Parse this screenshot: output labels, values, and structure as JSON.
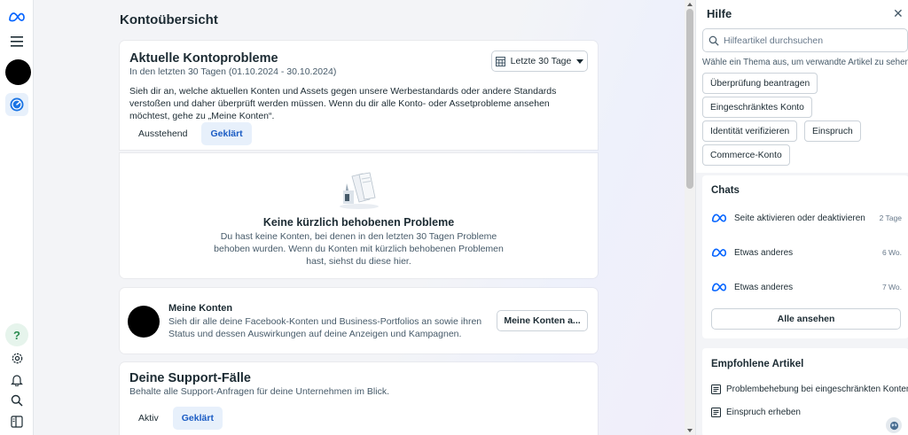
{
  "rail": {
    "logo_icon": "meta-logo-icon",
    "menu_icon": "hamburger-menu-icon",
    "dashboard_icon": "gauge-icon",
    "bottom_icons": [
      "help-circle-icon",
      "gear-icon",
      "bell-icon",
      "search-icon",
      "sidebar-panel-icon"
    ]
  },
  "main": {
    "title": "Kontoübersicht",
    "issues": {
      "title": "Aktuelle Kontoprobleme",
      "subtitle": "In den letzten 30 Tagen (01.10.2024 - 30.10.2024)",
      "date_filter": "Letzte 30 Tage",
      "description": "Sieh dir an, welche aktuellen Konten und Assets gegen unsere Werbestandards oder andere Standards verstoßen und daher überprüft werden müssen. Wenn du dir alle Konto- oder Assetprobleme ansehen möchtest, gehe zu „Meine Konten“.",
      "tabs": [
        "Ausstehend",
        "Geklärt"
      ],
      "selected_tab": "Geklärt",
      "empty_title": "Keine kürzlich behobenen Probleme",
      "empty_text": "Du hast keine Konten, bei denen in den letzten 30 Tagen Probleme behoben wurden. Wenn du Konten mit kürzlich behobenen Problemen hast, siehst du diese hier."
    },
    "accounts": {
      "title": "Meine Konten",
      "text": "Sieh dir alle deine Facebook-Konten und Business-Portfolios an sowie ihren Status und dessen Auswirkungen auf deine Anzeigen und Kampagnen.",
      "button": "Meine Konten a..."
    },
    "support": {
      "title": "Deine Support-Fälle",
      "subtitle": "Behalte alle Support-Anfragen für deine Unternehmen im Blick.",
      "tabs": [
        "Aktiv",
        "Geklärt"
      ],
      "selected_tab": "Geklärt"
    }
  },
  "help": {
    "title": "Hilfe",
    "search_placeholder": "Hilfeartikel durchsuchen",
    "hint": "Wähle ein Thema aus, um verwandte Artikel zu sehen",
    "topics": [
      "Überprüfung beantragen",
      "Eingeschränktes Konto",
      "Identität verifizieren",
      "Einspruch",
      "Commerce-Konto"
    ],
    "chats": {
      "title": "Chats",
      "items": [
        {
          "text": "Seite aktivieren oder deaktivieren",
          "time": "2 Tage"
        },
        {
          "text": "Etwas anderes",
          "time": "6 Wo."
        },
        {
          "text": "Etwas anderes",
          "time": "7 Wo."
        }
      ],
      "see_all": "Alle ansehen"
    },
    "articles": {
      "title": "Empfohlene Artikel",
      "items": [
        "Problembehebung bei eingeschränkten Konten",
        "Einspruch erheben"
      ]
    }
  },
  "colors": {
    "accent": "#1b5cc4",
    "tab_selected_bg": "#e7f0fb",
    "text": "#1c2b33",
    "meta_blue": "#0866ff"
  }
}
